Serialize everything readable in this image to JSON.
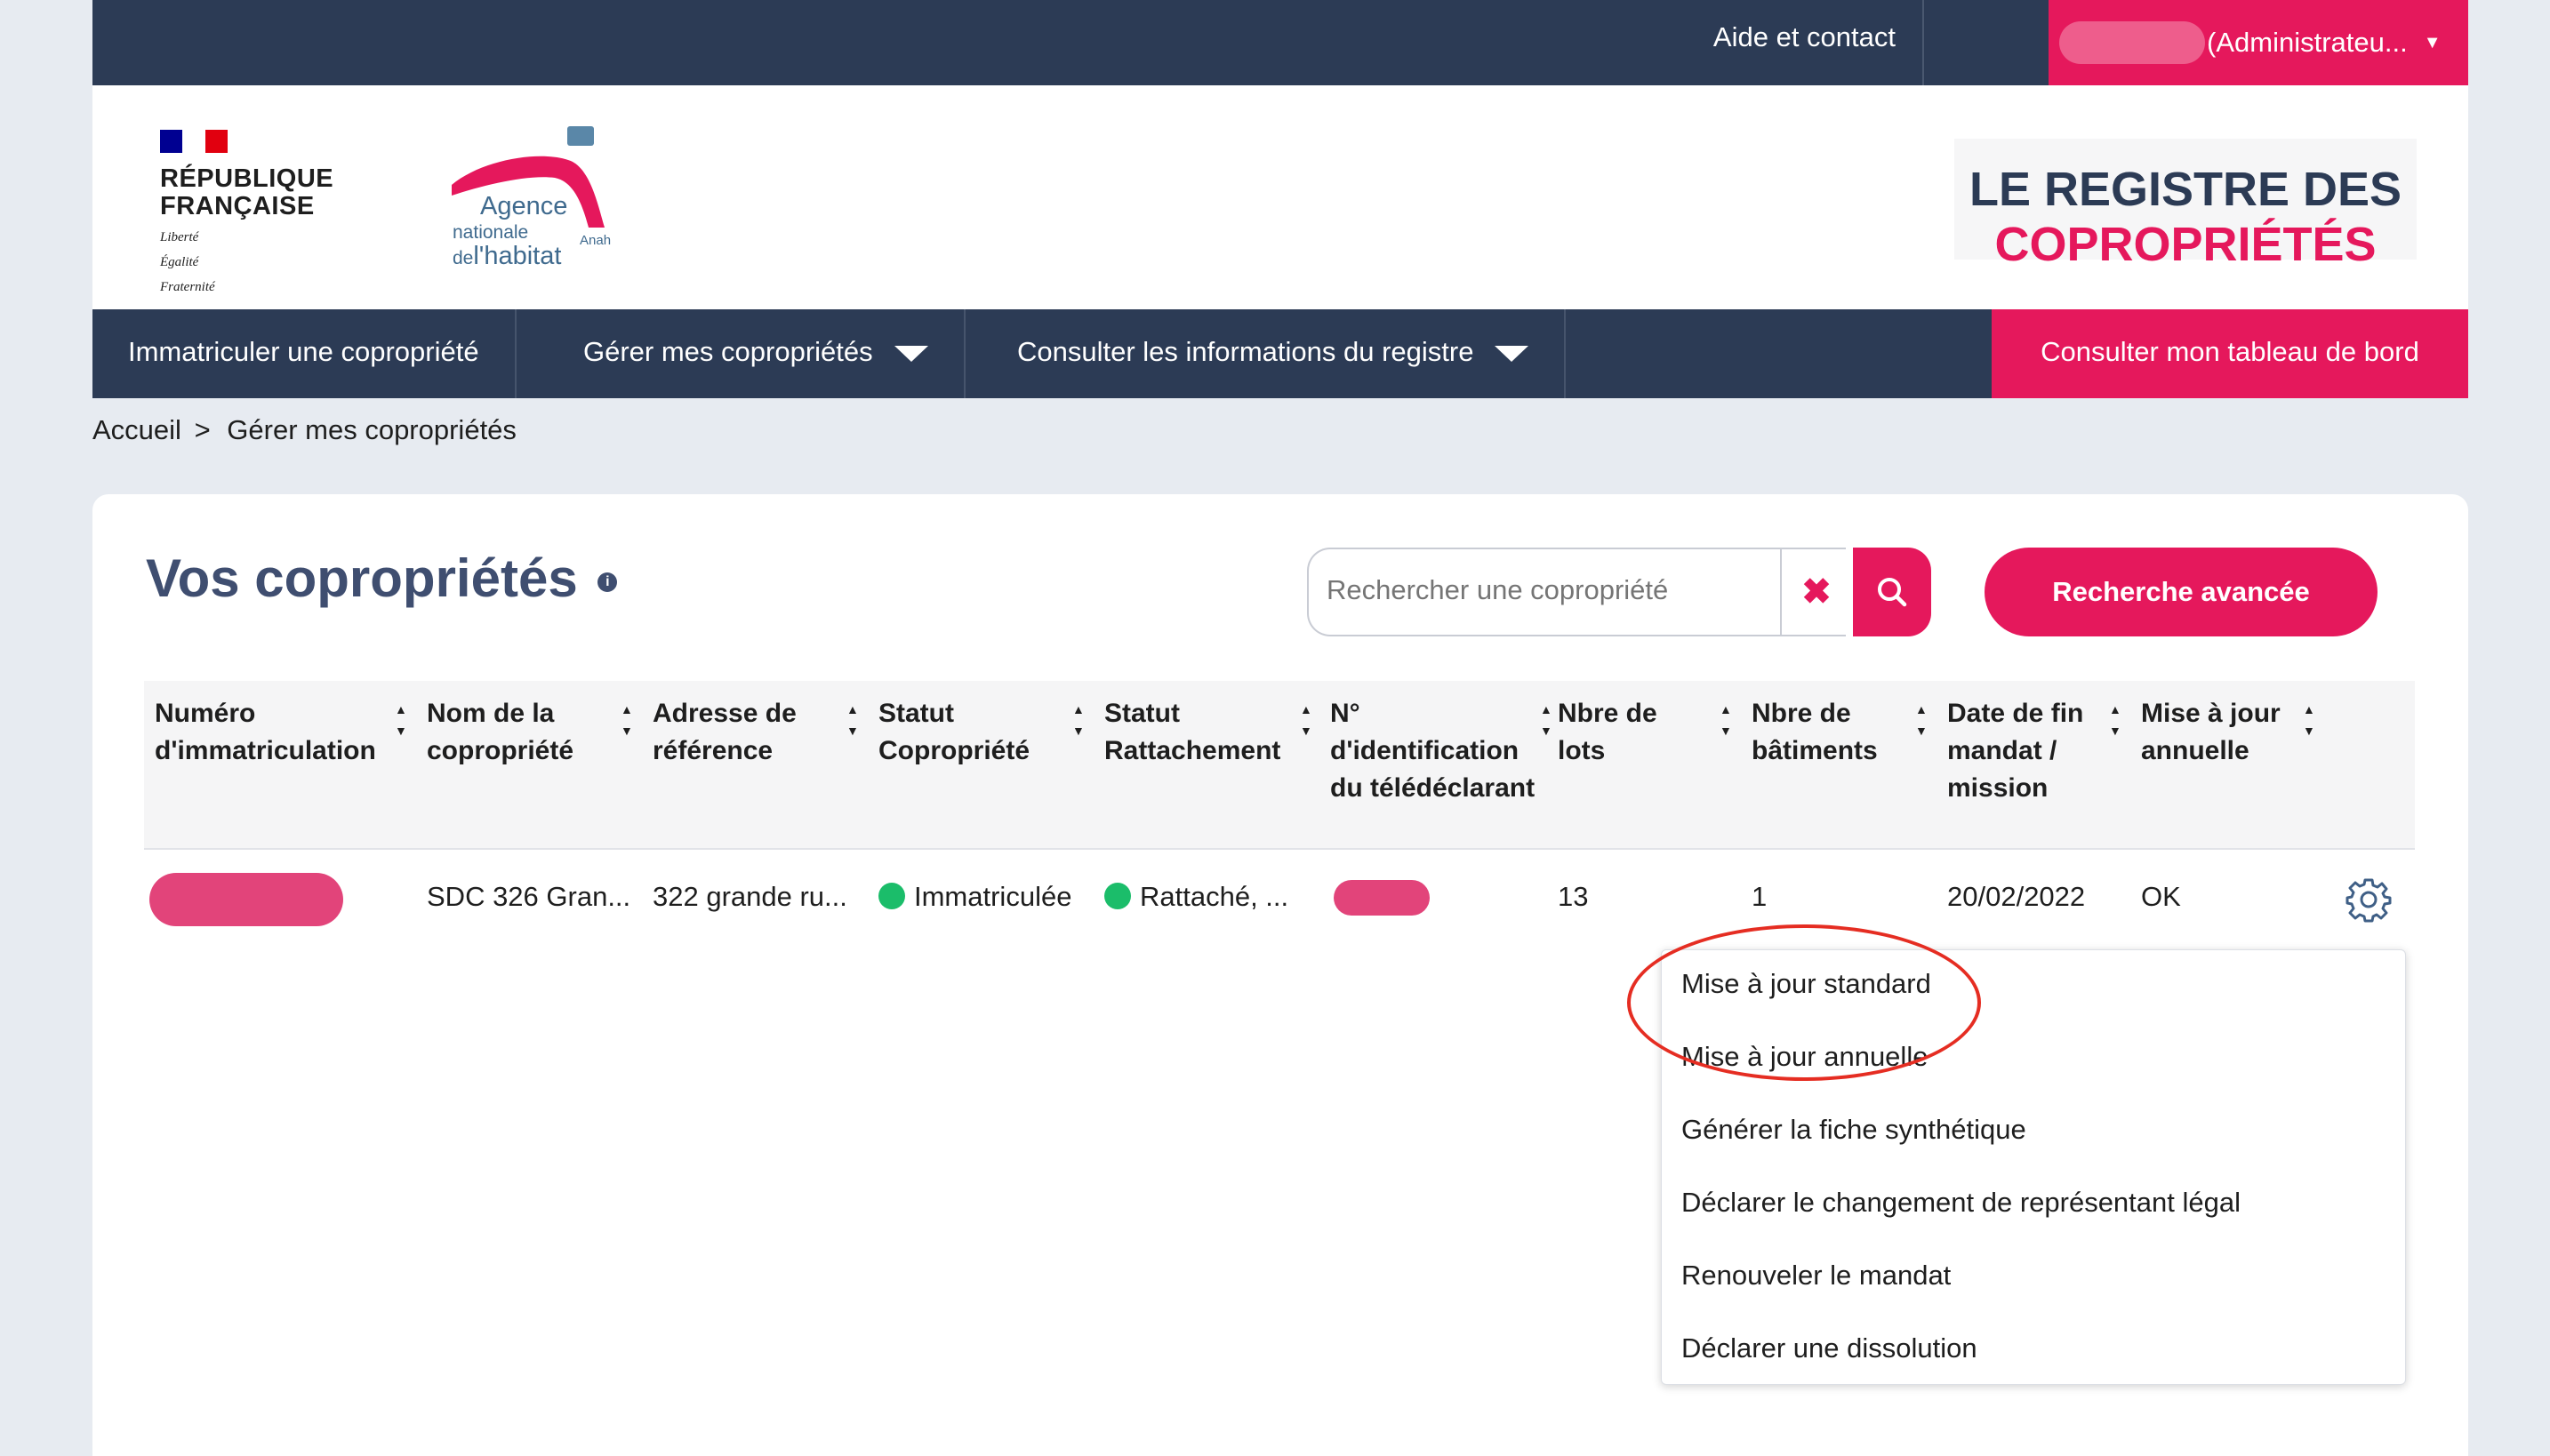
{
  "topbar": {
    "help_label": "Aide et contact",
    "account_label": "(Administrateu...",
    "icons": [
      "bell-icon",
      "caret-down-icon"
    ]
  },
  "header": {
    "republique": [
      "RÉPUBLIQUE",
      "FRANÇAISE"
    ],
    "devise": [
      "Liberté",
      "Égalité",
      "Fraternité"
    ],
    "anah": {
      "agence": "Agence",
      "nationale": "nationale",
      "de": "de",
      "habitat": "l'habitat",
      "anah": "Anah"
    },
    "registre": {
      "line1": "LE REGISTRE DES",
      "line2": "COPROPRIÉTÉS"
    }
  },
  "nav": {
    "items": [
      "Immatriculer une copropriété",
      "Gérer mes copropriétés",
      "Consulter les informations du registre"
    ],
    "cta": "Consulter mon tableau de bord"
  },
  "breadcrumb": {
    "home": "Accueil",
    "sep": ">",
    "current": "Gérer mes copropriétés"
  },
  "main": {
    "title": "Vos copropriétés",
    "info": "i",
    "search_placeholder": "Rechercher une copropriété",
    "advanced": "Recherche avancée"
  },
  "table": {
    "headers": [
      "Numéro d'immatriculation",
      "Nom de la copropriété",
      "Adresse de référence",
      "Statut Copropriété",
      "Statut Rattachement",
      "N° d'identification du télédéclarant",
      "Nbre de lots",
      "Nbre de bâtiments",
      "Date de fin mandat / mission",
      "Mise à jour annuelle"
    ],
    "row": {
      "nom": "SDC 326 Gran...",
      "adresse": "322 grande ru...",
      "statut": "Immatriculée",
      "rattachement": "Rattaché, ...",
      "lots": "13",
      "batiments": "1",
      "date": "20/02/2022",
      "maj": "OK"
    },
    "status_color": "#1bbd6a"
  },
  "menu": {
    "items": [
      "Mise à jour standard",
      "Mise à jour annuelle",
      "Générer la fiche synthétique",
      "Déclarer le changement de représentant légal",
      "Renouveler le mandat",
      "Déclarer une dissolution"
    ]
  },
  "colors": {
    "navy": "#2c3b55",
    "accent": "#e5185c",
    "annotation": "#e52d22"
  }
}
